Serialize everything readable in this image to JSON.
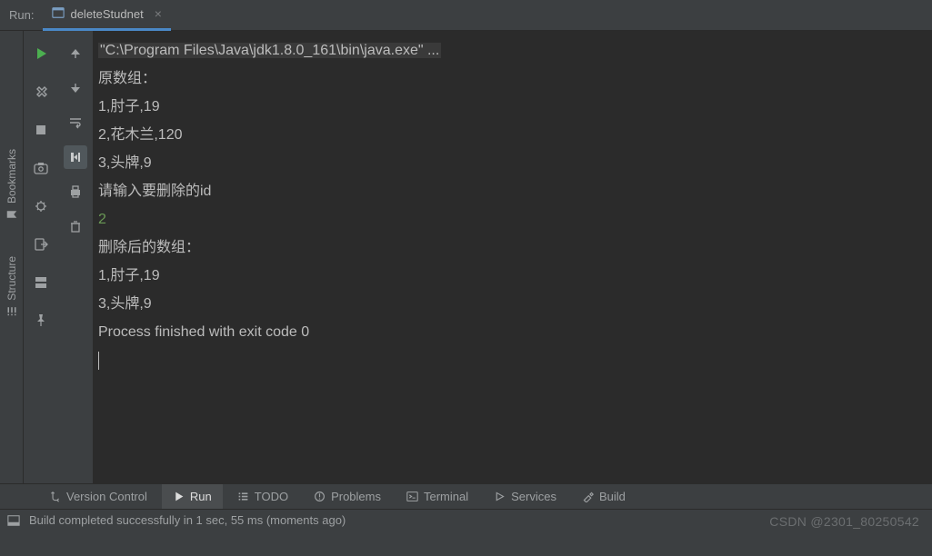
{
  "header": {
    "title": "Run:",
    "tab": "deleteStudnet"
  },
  "console": {
    "cmd": "\"C:\\Program Files\\Java\\jdk1.8.0_161\\bin\\java.exe\" ...",
    "lines": [
      "原数组：",
      "1,肘子,19",
      "2,花木兰,120",
      "3,头牌,9",
      "请输入要删除的id"
    ],
    "input": "2",
    "lines2": [
      "删除后的数组：",
      "1,肘子,19",
      "3,头牌,9",
      "",
      "Process finished with exit code 0"
    ]
  },
  "left_rail": {
    "bookmarks": "Bookmarks",
    "structure": "Structure"
  },
  "bottom_tabs": {
    "vcs": "Version Control",
    "run": "Run",
    "todo": "TODO",
    "problems": "Problems",
    "terminal": "Terminal",
    "services": "Services",
    "build": "Build"
  },
  "status": {
    "msg": "Build completed successfully in 1 sec, 55 ms (moments ago)"
  },
  "watermark": "CSDN @2301_80250542"
}
